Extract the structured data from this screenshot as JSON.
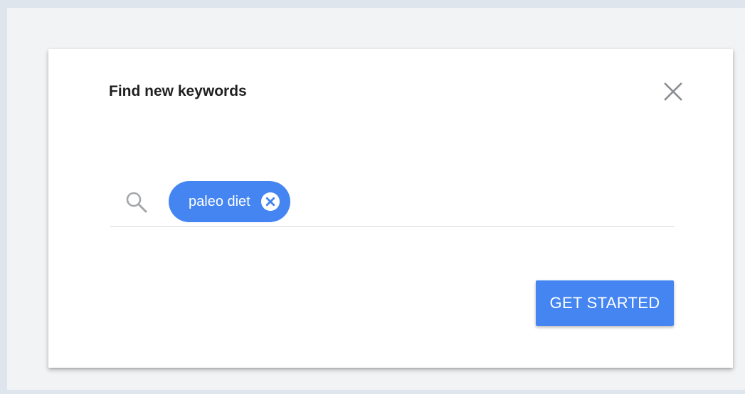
{
  "dialog": {
    "title": "Find new keywords",
    "close_icon": "close-icon"
  },
  "search": {
    "icon": "search-icon",
    "chips": [
      {
        "label": "paleo diet",
        "remove_icon": "clear-circle-icon"
      }
    ]
  },
  "actions": {
    "get_started_label": "GET STARTED"
  },
  "colors": {
    "accent": "#4485f2",
    "page_background": "#f2f3f5",
    "frame_border": "#dfe5ec",
    "dialog_background": "#ffffff",
    "title_text": "#1f1f1f",
    "icon_gray": "#8a8d91",
    "divider": "#d5d8dc"
  }
}
